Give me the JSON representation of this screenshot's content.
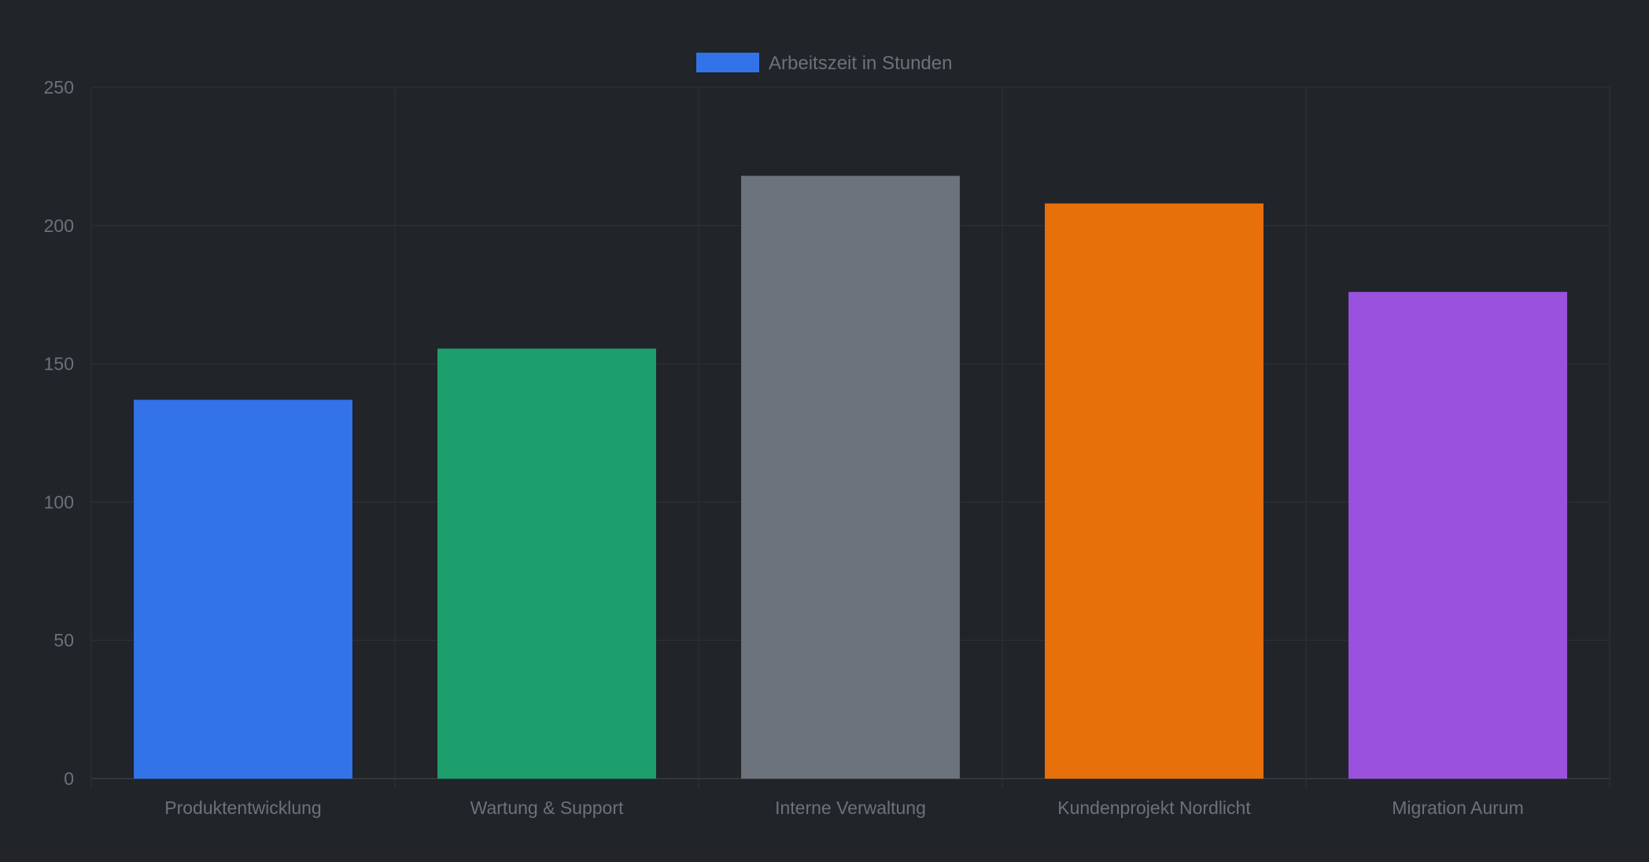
{
  "chart_data": {
    "type": "bar",
    "categories": [
      "Produktentwicklung",
      "Wartung & Support",
      "Interne Verwaltung",
      "Kundenprojekt Nordlicht",
      "Migration Aurum"
    ],
    "series": [
      {
        "name": "Arbeitszeit in Stunden",
        "values": [
          137,
          155.5,
          218,
          208,
          176
        ],
        "colors": [
          "#3273ea",
          "#1c9e6d",
          "#6c737d",
          "#e8700a",
          "#9a52de"
        ]
      }
    ],
    "legend": {
      "label": "Arbeitszeit in Stunden",
      "color": "#3273ea",
      "position": "top-center"
    },
    "y_ticks": [
      "0",
      "50",
      "100",
      "150",
      "200",
      "250"
    ],
    "ylim": [
      0,
      250
    ],
    "grid": true,
    "title": "",
    "xlabel": "",
    "ylabel": ""
  },
  "colors": {
    "background": "#212429",
    "grid": "#2b2e33",
    "tick_text": "#6e7178"
  }
}
